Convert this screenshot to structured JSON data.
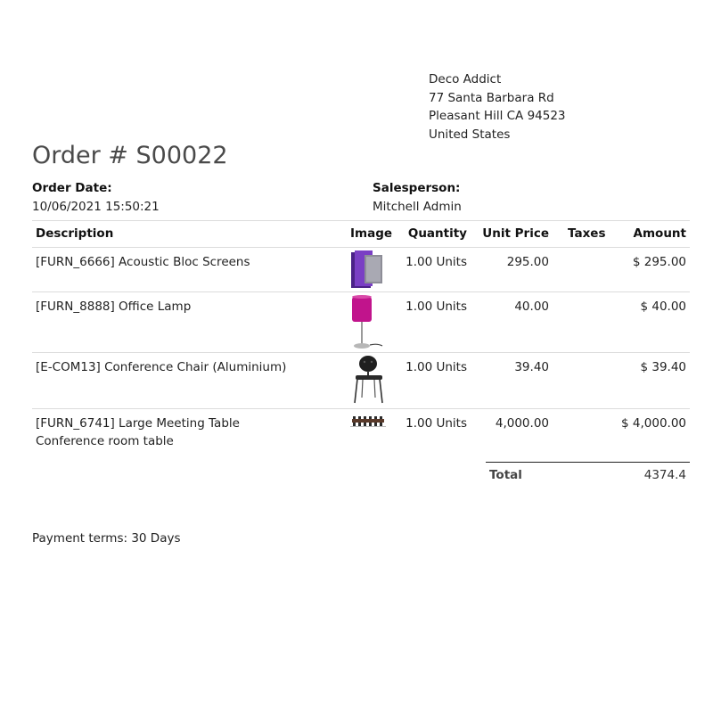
{
  "customer": {
    "name": "Deco Addict",
    "street": "77 Santa Barbara Rd",
    "city_line": "Pleasant Hill CA 94523",
    "country": "United States"
  },
  "order": {
    "title": "Order # S00022",
    "date_label": "Order Date:",
    "date_value": "10/06/2021 15:50:21",
    "salesperson_label": "Salesperson:",
    "salesperson_value": "Mitchell Admin"
  },
  "table": {
    "headers": {
      "description": "Description",
      "image": "Image",
      "quantity": "Quantity",
      "unit_price": "Unit Price",
      "taxes": "Taxes",
      "amount": "Amount"
    },
    "rows": [
      {
        "description": "[FURN_6666] Acoustic Bloc Screens",
        "description2": "",
        "image_icon": "acoustic-screens-image",
        "quantity": "1.00 Units",
        "unit_price": "295.00",
        "taxes": "",
        "amount": "$ 295.00"
      },
      {
        "description": "[FURN_8888] Office Lamp",
        "description2": "",
        "image_icon": "office-lamp-image",
        "quantity": "1.00 Units",
        "unit_price": "40.00",
        "taxes": "",
        "amount": "$ 40.00"
      },
      {
        "description": "[E-COM13] Conference Chair (Aluminium)",
        "description2": "",
        "image_icon": "conference-chair-image",
        "quantity": "1.00 Units",
        "unit_price": "39.40",
        "taxes": "",
        "amount": "$ 39.40"
      },
      {
        "description": "[FURN_6741] Large Meeting Table",
        "description2": "Conference room table",
        "image_icon": "meeting-table-image",
        "quantity": "1.00 Units",
        "unit_price": "4,000.00",
        "taxes": "",
        "amount": "$ 4,000.00"
      }
    ]
  },
  "totals": {
    "label": "Total",
    "value": "4374.4"
  },
  "payment_terms": "Payment terms: 30 Days",
  "colors": {
    "screen_purple": "#5b2d9a",
    "lamp_magenta": "#c1148c"
  }
}
